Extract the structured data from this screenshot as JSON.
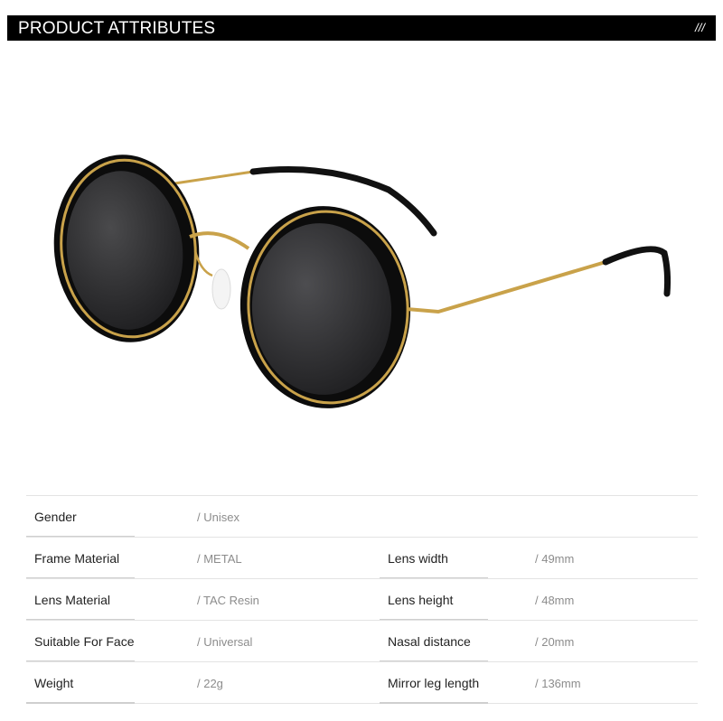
{
  "header": {
    "title": "PRODUCT ATTRIBUTES",
    "mark": "///"
  },
  "colors": {
    "header_bg": "#000000",
    "frame_gold": "#c9a24a",
    "lens_dark": "#2b2b2d",
    "rim_black": "#0c0c0c"
  },
  "specs": [
    {
      "label1": "Gender",
      "value1": "/ Unisex",
      "label2": "",
      "value2": ""
    },
    {
      "label1": "Frame Material",
      "value1": "/ METAL",
      "label2": "Lens width",
      "value2": "/ 49mm"
    },
    {
      "label1": "Lens Material",
      "value1": "/ TAC Resin",
      "label2": "Lens height",
      "value2": "/ 48mm"
    },
    {
      "label1": "Suitable For Face",
      "value1": "/ Universal",
      "label2": "Nasal distance",
      "value2": "/ 20mm"
    },
    {
      "label1": "Weight",
      "value1": "/ 22g",
      "label2": "Mirror leg length",
      "value2": "/ 136mm"
    }
  ]
}
